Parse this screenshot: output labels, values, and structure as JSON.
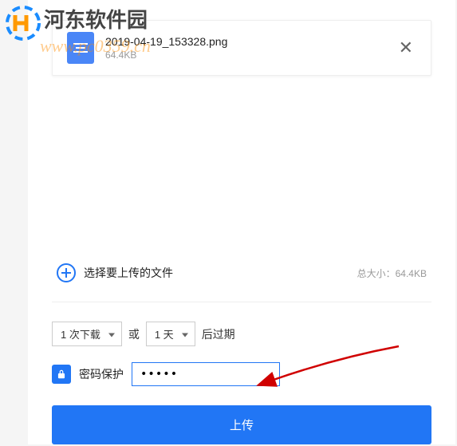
{
  "watermark": {
    "title": "河东软件园",
    "url": "www.pc0359.cn"
  },
  "file": {
    "name": "2019-04-19_153328.png",
    "size": "64.4KB"
  },
  "select": {
    "label": "选择要上传的文件",
    "total_label": "总大小：",
    "total_value": "64.4KB"
  },
  "expire": {
    "downloads": "1 次下载",
    "or": "或",
    "days": "1 天",
    "after": "后过期"
  },
  "password": {
    "label": "密码保护",
    "value": "•••••"
  },
  "upload_label": "上传"
}
